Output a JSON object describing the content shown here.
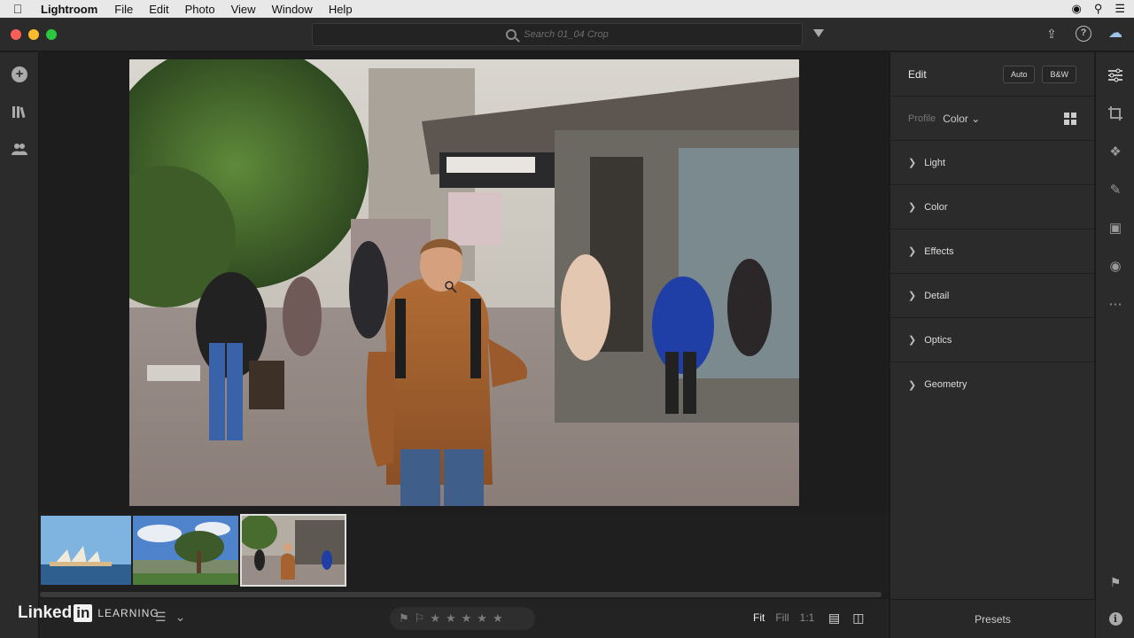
{
  "menubar": {
    "app_name": "Lightroom",
    "items": [
      "File",
      "Edit",
      "Photo",
      "View",
      "Window",
      "Help"
    ]
  },
  "titlebar": {
    "search_placeholder": "Search 01_04 Crop"
  },
  "left_rail": {
    "items": [
      "add-photos",
      "my-photos",
      "shared"
    ]
  },
  "edit_panel": {
    "title": "Edit",
    "auto_label": "Auto",
    "bw_label": "B&W",
    "profile_label": "Profile",
    "profile_value": "Color",
    "sections": [
      "Light",
      "Color",
      "Effects",
      "Detail",
      "Optics",
      "Geometry"
    ],
    "presets_label": "Presets"
  },
  "bottombar": {
    "brand": "Linked",
    "brand_in": "in",
    "brand_learning": "LEARNING",
    "fit_label": "Fit",
    "fill_label": "Fill",
    "ratio_label": "1:1"
  },
  "filmstrip": {
    "thumbnails": [
      "opera-house",
      "coastal-tree",
      "street-portrait"
    ],
    "selected_index": 2
  },
  "colors": {
    "panel_bg": "#2b2b2b",
    "canvas_bg": "#1d1d1d",
    "accent_cloud": "#9fc4e8"
  }
}
